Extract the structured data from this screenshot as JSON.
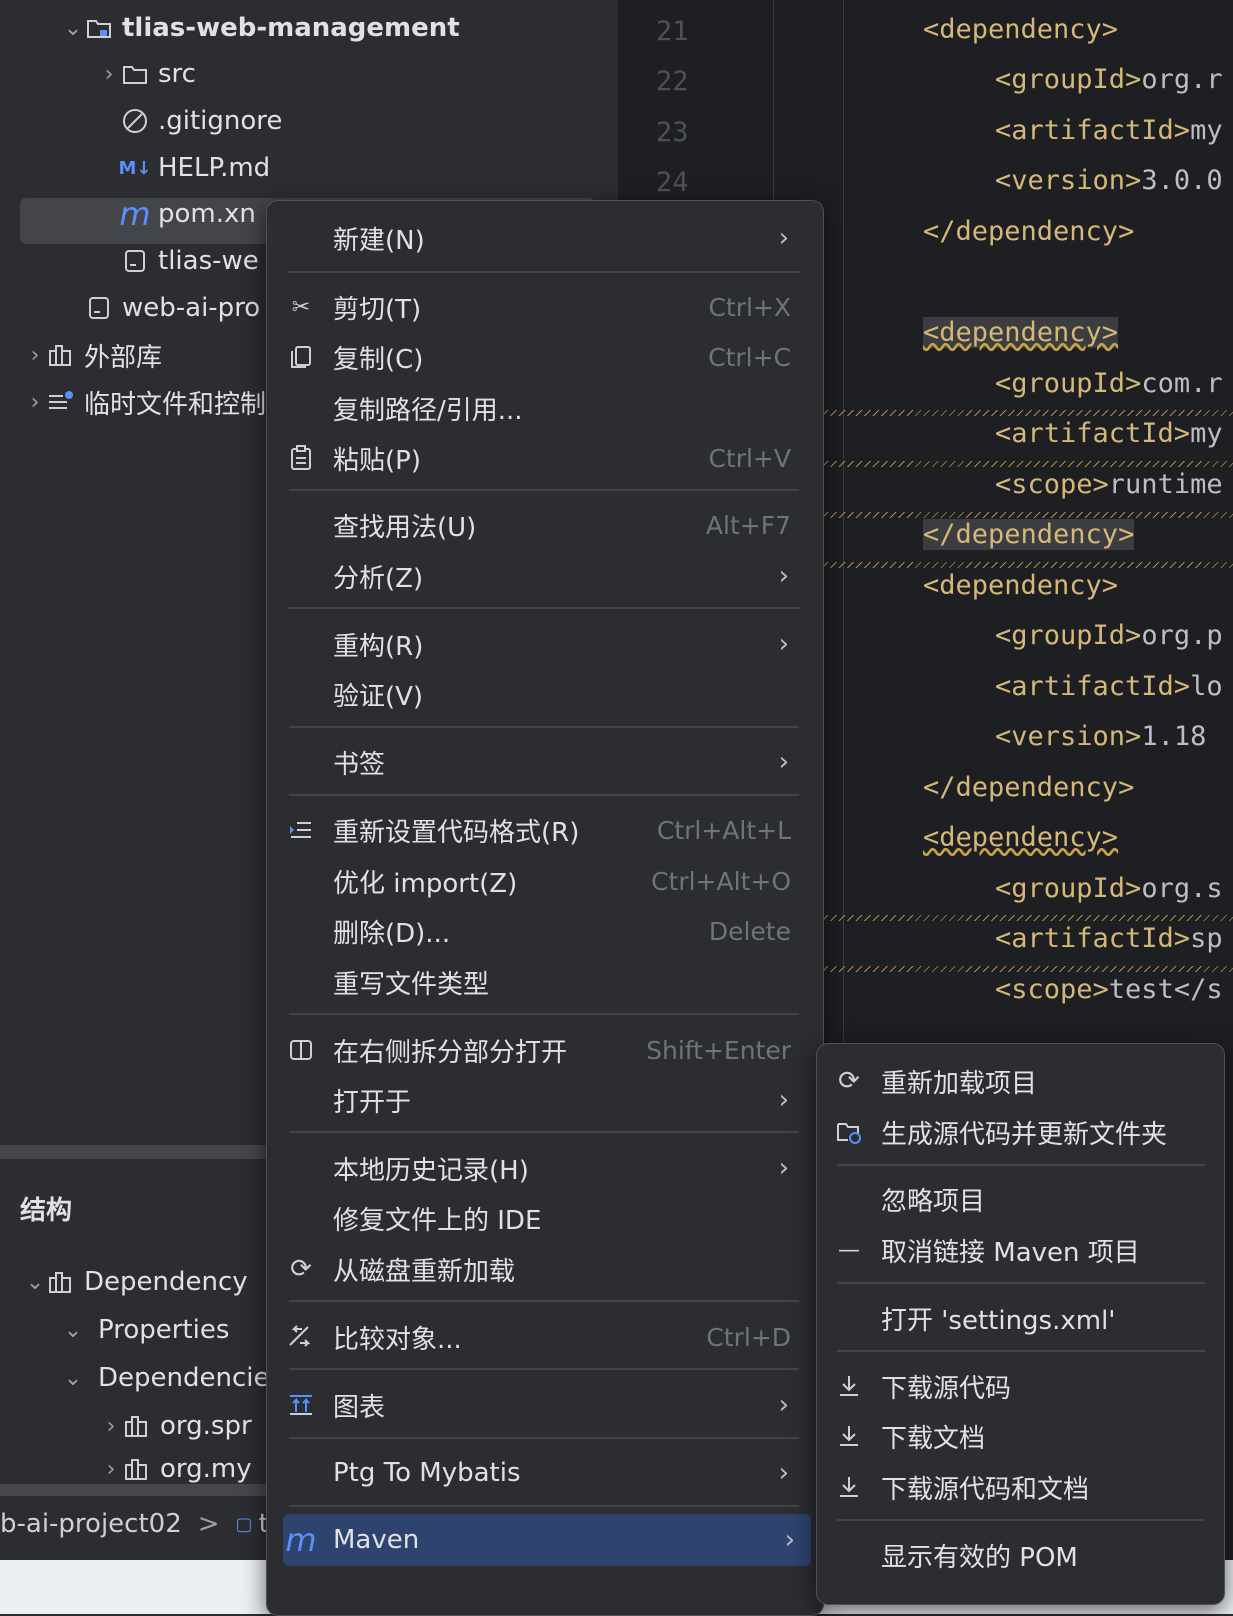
{
  "project_tree": {
    "items": [
      {
        "label": "tlias-web-management",
        "icon": "module-folder-icon"
      },
      {
        "label": "src",
        "icon": "folder-icon"
      },
      {
        "label": ".gitignore",
        "icon": "ignored-file-icon"
      },
      {
        "label": "HELP.md",
        "icon": "markdown-icon",
        "badge": "M↓"
      },
      {
        "label": "pom.xn",
        "icon": "maven-icon",
        "badge": "m"
      },
      {
        "label": "tlias-we",
        "icon": "file-icon"
      },
      {
        "label": "web-ai-pro",
        "icon": "file-icon"
      },
      {
        "label": "外部库",
        "icon": "library-icon"
      },
      {
        "label": "临时文件和控制",
        "icon": "scratches-icon"
      }
    ]
  },
  "editor": {
    "line_numbers": [
      "21",
      "22",
      "23",
      "24"
    ],
    "lines": [
      {
        "text": "<dependency>",
        "indent": 1
      },
      {
        "text": "<groupId>org.r",
        "indent": 2
      },
      {
        "text": "<artifactId>my",
        "indent": 2
      },
      {
        "text": "<version>3.0.0",
        "indent": 2
      },
      {
        "text": "</dependency>",
        "indent": 1
      },
      {
        "text": "",
        "indent": 0
      },
      {
        "text": "<dependency>",
        "indent": 1
      },
      {
        "text": "<groupId>com.r",
        "indent": 2
      },
      {
        "text": "<artifactId>my",
        "indent": 2
      },
      {
        "text": "<scope>runtime",
        "indent": 2
      },
      {
        "text": "</dependency>",
        "indent": 1
      },
      {
        "text": "<dependency>",
        "indent": 1
      },
      {
        "text": "<groupId>org.p",
        "indent": 2
      },
      {
        "text": "<artifactId>lo",
        "indent": 2
      },
      {
        "text": "<version>1.18",
        "indent": 2
      },
      {
        "text": "</dependency>",
        "indent": 1
      },
      {
        "text": "<dependency>",
        "indent": 1
      },
      {
        "text": "<groupId>org.s",
        "indent": 2
      },
      {
        "text": "<artifactId>sp",
        "indent": 2
      },
      {
        "text": "<scope>test</s",
        "indent": 2
      }
    ]
  },
  "structure": {
    "title": "结构",
    "items": [
      {
        "label": "Dependency",
        "icon": "library-icon"
      },
      {
        "label": "Properties"
      },
      {
        "label": "Dependencie"
      },
      {
        "label": "org.spr",
        "icon": "library-icon"
      },
      {
        "label": "org.my",
        "icon": "library-icon"
      }
    ]
  },
  "breadcrumb": {
    "project": "b-ai-project02",
    "sep": ">",
    "next": "t"
  },
  "context_menu": {
    "items": [
      {
        "label": "新建(N)",
        "shortcut": "",
        "submenu": true
      },
      {
        "label": "剪切(T)",
        "shortcut": "Ctrl+X",
        "icon": "scissors-icon"
      },
      {
        "label": "复制(C)",
        "shortcut": "Ctrl+C",
        "icon": "copy-icon"
      },
      {
        "label": "复制路径/引用...",
        "shortcut": ""
      },
      {
        "label": "粘贴(P)",
        "shortcut": "Ctrl+V",
        "icon": "paste-icon"
      },
      {
        "label": "查找用法(U)",
        "shortcut": "Alt+F7"
      },
      {
        "label": "分析(Z)",
        "shortcut": "",
        "submenu": true
      },
      {
        "label": "重构(R)",
        "shortcut": "",
        "submenu": true
      },
      {
        "label": "验证(V)",
        "shortcut": ""
      },
      {
        "label": "书签",
        "shortcut": "",
        "submenu": true
      },
      {
        "label": "重新设置代码格式(R)",
        "shortcut": "Ctrl+Alt+L",
        "icon": "reformat-icon"
      },
      {
        "label": "优化 import(Z)",
        "shortcut": "Ctrl+Alt+O"
      },
      {
        "label": "删除(D)...",
        "shortcut": "Delete"
      },
      {
        "label": "重写文件类型",
        "shortcut": ""
      },
      {
        "label": "在右侧拆分部分打开",
        "shortcut": "Shift+Enter",
        "icon": "split-icon"
      },
      {
        "label": "打开于",
        "shortcut": "",
        "submenu": true
      },
      {
        "label": "本地历史记录(H)",
        "shortcut": "",
        "submenu": true
      },
      {
        "label": "修复文件上的 IDE",
        "shortcut": ""
      },
      {
        "label": "从磁盘重新加载",
        "shortcut": "",
        "icon": "reload-icon"
      },
      {
        "label": "比较对象...",
        "shortcut": "Ctrl+D",
        "icon": "compare-icon"
      },
      {
        "label": "图表",
        "shortcut": "",
        "submenu": true,
        "icon": "diagram-icon"
      },
      {
        "label": "Ptg To Mybatis",
        "shortcut": "",
        "submenu": true
      },
      {
        "label": "Maven",
        "shortcut": "",
        "submenu": true,
        "icon": "maven-icon"
      }
    ],
    "submenu_arrow": "›"
  },
  "maven_submenu": {
    "items": [
      {
        "label": "重新加载项目",
        "icon": "reload-icon"
      },
      {
        "label": "生成源代码并更新文件夹",
        "icon": "generate-folder-icon"
      },
      {
        "label": "忽略项目"
      },
      {
        "label": "取消链接 Maven 项目",
        "icon": "minus-icon"
      },
      {
        "label": "打开 'settings.xml'"
      },
      {
        "label": "下载源代码",
        "icon": "download-icon"
      },
      {
        "label": "下载文档",
        "icon": "download-icon"
      },
      {
        "label": "下载源代码和文档",
        "icon": "download-icon"
      },
      {
        "label": "显示有效的 POM"
      }
    ]
  },
  "colors": {
    "bg": "#2b2d30",
    "editor_bg": "#1e1f22",
    "tag": "#d5b778",
    "selection": "#2e436e",
    "maven_blue": "#5b8ff9"
  }
}
